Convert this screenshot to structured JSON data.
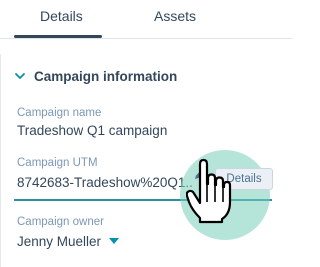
{
  "tabs": [
    {
      "label": "Details",
      "active": true
    },
    {
      "label": "Assets",
      "active": false
    }
  ],
  "section": {
    "title": "Campaign information",
    "expanded": true,
    "icon": "chevron-down-icon"
  },
  "fields": {
    "name": {
      "label": "Campaign name",
      "value": "Tradeshow Q1 campaign"
    },
    "utm": {
      "label": "Campaign UTM",
      "value": "8742683-Tradeshow%20Q1...",
      "action_label": "Details",
      "edit_icon": "pencil-icon"
    },
    "owner": {
      "label": "Campaign owner",
      "value": "Jenny Mueller",
      "icon": "caret-down-icon"
    }
  },
  "cursor": {
    "icon": "hand-pointer-icon"
  },
  "colors": {
    "text": "#33475b",
    "label": "#7c98b6",
    "accent_teal": "#2e8fa4",
    "link_blue": "#0091ae",
    "highlight": "#78cdb9"
  }
}
